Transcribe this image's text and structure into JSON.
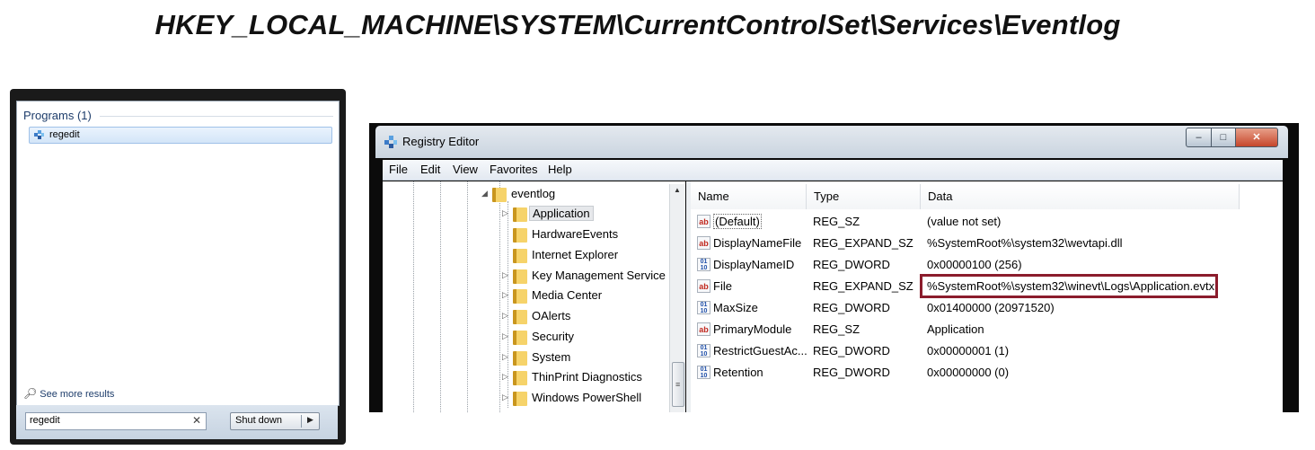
{
  "header": {
    "registry_path": "HKEY_LOCAL_MACHINE\\SYSTEM\\CurrentControlSet\\Services\\Eventlog"
  },
  "start_menu": {
    "programs_header": "Programs (1)",
    "program_item": "regedit",
    "see_more": "See more results",
    "search_value": "regedit",
    "search_clear_icon": "close-icon",
    "shutdown_label": "Shut down"
  },
  "registry_editor": {
    "title": "Registry Editor",
    "window_buttons": {
      "minimize": "minimize-icon",
      "maximize": "maximize-icon",
      "close": "close-icon"
    },
    "menu": [
      "File",
      "Edit",
      "View",
      "Favorites",
      "Help"
    ],
    "tree": {
      "parent": "eventlog",
      "children": [
        {
          "label": "Application",
          "expandable": true,
          "selected": true
        },
        {
          "label": "HardwareEvents",
          "expandable": false
        },
        {
          "label": "Internet Explorer",
          "expandable": false
        },
        {
          "label": "Key Management Service",
          "expandable": true
        },
        {
          "label": "Media Center",
          "expandable": true
        },
        {
          "label": "OAlerts",
          "expandable": true
        },
        {
          "label": "Security",
          "expandable": true
        },
        {
          "label": "System",
          "expandable": true
        },
        {
          "label": "ThinPrint Diagnostics",
          "expandable": true
        },
        {
          "label": "Windows PowerShell",
          "expandable": true
        }
      ]
    },
    "columns": [
      "Name",
      "Type",
      "Data"
    ],
    "values": [
      {
        "icon": "ab",
        "name": "(Default)",
        "type": "REG_SZ",
        "data": "(value not set)"
      },
      {
        "icon": "ab",
        "name": "DisplayNameFile",
        "type": "REG_EXPAND_SZ",
        "data": "%SystemRoot%\\system32\\wevtapi.dll"
      },
      {
        "icon": "dword",
        "name": "DisplayNameID",
        "type": "REG_DWORD",
        "data": "0x00000100 (256)"
      },
      {
        "icon": "ab",
        "name": "File",
        "type": "REG_EXPAND_SZ",
        "data": "%SystemRoot%\\system32\\winevt\\Logs\\Application.evtx",
        "highlighted": true
      },
      {
        "icon": "dword",
        "name": "MaxSize",
        "type": "REG_DWORD",
        "data": "0x01400000 (20971520)"
      },
      {
        "icon": "ab",
        "name": "PrimaryModule",
        "type": "REG_SZ",
        "data": "Application"
      },
      {
        "icon": "dword",
        "name": "RestrictGuestAc...",
        "type": "REG_DWORD",
        "data": "0x00000001 (1)"
      },
      {
        "icon": "dword",
        "name": "Retention",
        "type": "REG_DWORD",
        "data": "0x00000000 (0)"
      }
    ],
    "highlight_color": "#8b1c2c"
  }
}
